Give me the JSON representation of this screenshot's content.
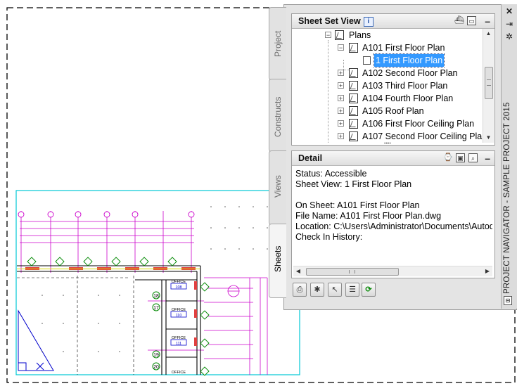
{
  "palette": {
    "title": "PROJECT NAVIGATOR - SAMPLE PROJECT 2015",
    "tabs": [
      "Project",
      "Constructs",
      "Views",
      "Sheets"
    ],
    "active_tab": "Sheets",
    "strip_icons": [
      "close-icon",
      "autohide-icon",
      "properties-icon"
    ]
  },
  "sheet_set_view": {
    "title": "Sheet Set View",
    "minimize": "–",
    "tree": {
      "folder": "Plans",
      "sheets": [
        {
          "label": "A101 First Floor Plan",
          "expanded": true,
          "children": [
            "1 First Floor Plan"
          ]
        },
        {
          "label": "A102 Second Floor Plan",
          "expanded": false
        },
        {
          "label": "A103 Third Floor Plan",
          "expanded": false
        },
        {
          "label": "A104 Fourth Floor Plan",
          "expanded": false
        },
        {
          "label": "A105 Roof Plan",
          "expanded": false
        },
        {
          "label": "A106 First Floor Ceiling Plan",
          "expanded": false
        },
        {
          "label": "A107 Second Floor Ceiling Plan",
          "expanded": false
        }
      ],
      "selected": "1 First Floor Plan"
    }
  },
  "detail": {
    "title": "Detail",
    "minimize": "–",
    "lines": [
      "Status: Accessible",
      "Sheet View: 1 First Floor Plan",
      "",
      "On Sheet: A101 First Floor Plan",
      "File Name: A101 First Floor Plan.dwg",
      "Location: C:\\Users\\Administrator\\Documents\\Autode",
      "Check In History:"
    ]
  },
  "bottom_toolbar": [
    "plot-icon",
    "new-view-icon",
    "regenerate-icon",
    "properties-icon",
    "refresh-icon"
  ],
  "drawing": {
    "room_labels": [
      {
        "name": "OFFICE",
        "number": "108"
      },
      {
        "name": "OFFICE",
        "number": "110"
      },
      {
        "name": "OFFICE",
        "number": "111"
      },
      {
        "name": "OFFICE",
        "number": ""
      }
    ],
    "grid_tags": [
      "18",
      "17",
      "19",
      "20"
    ],
    "colors": {
      "cad_magenta": "#cc00cc",
      "cad_cyan": "#00c8d6",
      "cad_green": "#00a000",
      "cad_blue": "#0000cc",
      "selection": "#3399ff"
    }
  }
}
